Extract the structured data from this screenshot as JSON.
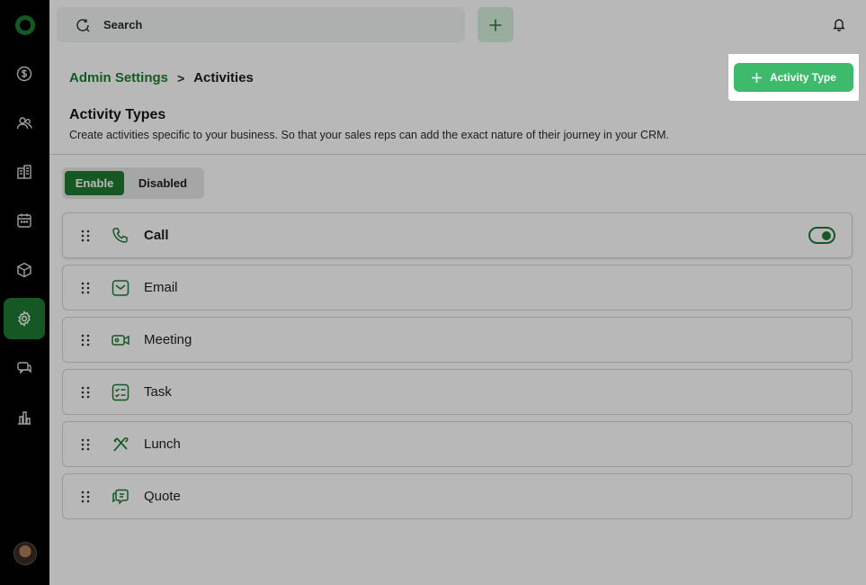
{
  "search": {
    "placeholder": "Search"
  },
  "breadcrumb": {
    "parent": "Admin Settings",
    "separator": ">",
    "current": "Activities"
  },
  "cta": {
    "label": "Activity Type"
  },
  "section": {
    "title": "Activity Types",
    "description": "Create activities specific to  your business. So that  your sales reps can add the exact nature of their journey in your CRM."
  },
  "segment": {
    "enable_label": "Enable",
    "disabled_label": "Disabled",
    "selected": "Enable"
  },
  "activities": [
    {
      "label": "Call",
      "icon": "phone-icon"
    },
    {
      "label": "Email",
      "icon": "email-icon"
    },
    {
      "label": "Meeting",
      "icon": "video-icon"
    },
    {
      "label": "Task",
      "icon": "checklist-icon"
    },
    {
      "label": "Lunch",
      "icon": "utensils-icon"
    },
    {
      "label": "Quote",
      "icon": "quote-icon"
    }
  ],
  "sidebar": {
    "items": [
      {
        "icon": "dollar-icon"
      },
      {
        "icon": "users-icon"
      },
      {
        "icon": "building-icon"
      },
      {
        "icon": "calendar-icon"
      },
      {
        "icon": "box-icon"
      },
      {
        "icon": "gear-icon",
        "active": true
      },
      {
        "icon": "chat-icon"
      },
      {
        "icon": "bar-chart-icon"
      }
    ]
  },
  "colors": {
    "accent": "#1f7a32",
    "cta": "#3dba6b",
    "sidebar": "#000000"
  }
}
